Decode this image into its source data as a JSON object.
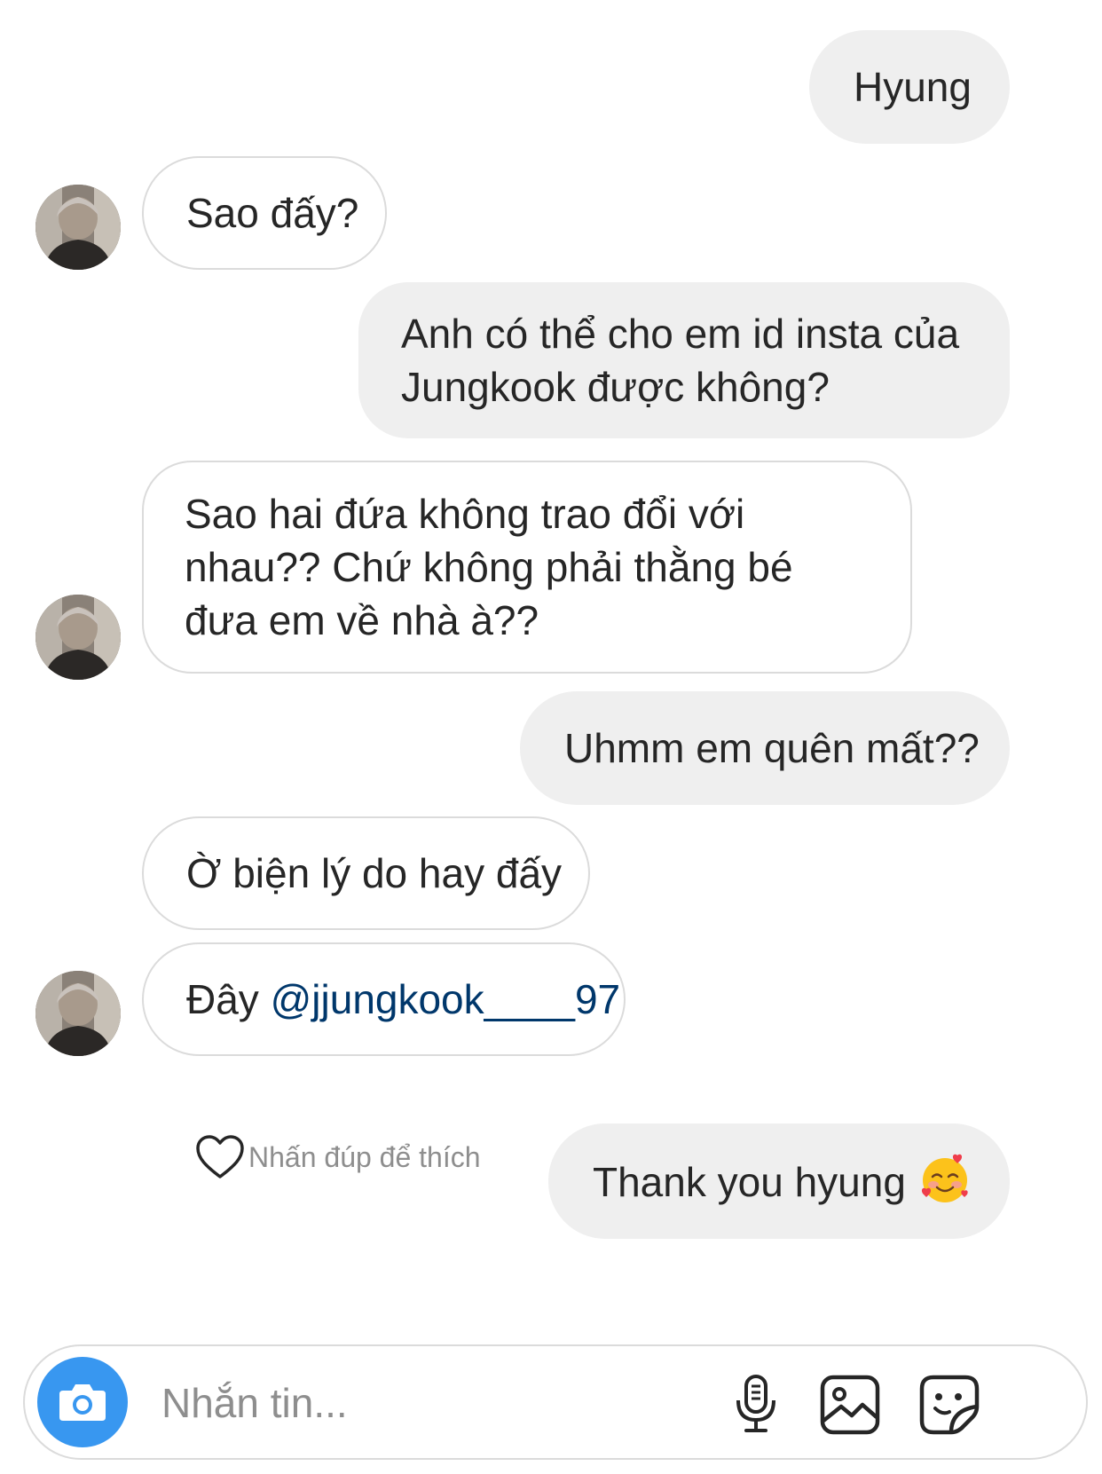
{
  "messages": [
    {
      "from": "me",
      "text": "Hyung"
    },
    {
      "from": "them",
      "text": "Sao đấy?"
    },
    {
      "from": "me",
      "text": "Anh có thể cho em id insta của Jungkook được không?"
    },
    {
      "from": "them",
      "text": "Sao hai đứa không trao đổi với nhau?? Chứ không phải thằng bé đưa em về nhà à??"
    },
    {
      "from": "me",
      "text": "Uhmm em quên mất??"
    },
    {
      "from": "them",
      "text": "Ờ biện lý do hay đấy"
    },
    {
      "from": "them",
      "text": "Đây",
      "mention": "@jjungkook____97"
    },
    {
      "from": "me",
      "text": "Thank you hyung",
      "emoji": "smiling-face-with-hearts"
    }
  ],
  "like_hint": {
    "text": "Nhấn đúp để thích",
    "icon": "heart-outline-icon"
  },
  "composer": {
    "placeholder": "Nhắn tin...",
    "icons": [
      "camera-icon",
      "microphone-icon",
      "gallery-icon",
      "sticker-icon"
    ]
  },
  "colors": {
    "sent_bubble": "#efefef",
    "received_border": "#dbdbdb",
    "mention": "#00376b",
    "camera_button": "#3897f0",
    "hint_text": "#8e8e8e"
  }
}
